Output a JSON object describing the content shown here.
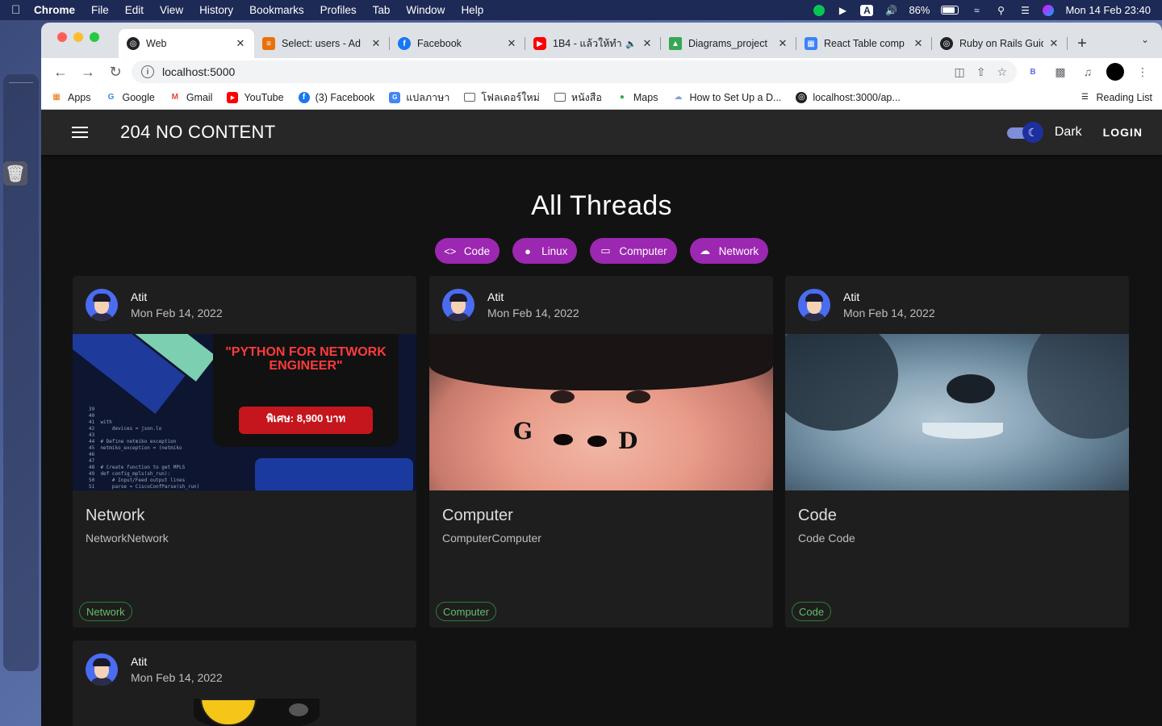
{
  "menubar": {
    "app_name": "Chrome",
    "items": [
      "File",
      "Edit",
      "View",
      "History",
      "Bookmarks",
      "Profiles",
      "Tab",
      "Window",
      "Help"
    ],
    "battery": "86%",
    "datetime": "Mon 14 Feb  23:40",
    "input_indicator": "A"
  },
  "browser": {
    "tabs": [
      {
        "label": "Web",
        "icon": "globe-icon",
        "color": "#202124",
        "active": true
      },
      {
        "label": "Select: users - Ad",
        "icon": "db-icon",
        "color": "#e8710a"
      },
      {
        "label": "Facebook",
        "icon": "facebook-icon",
        "color": "#1877f2"
      },
      {
        "label": "1B4 - แล้วให้ทำ",
        "icon": "youtube-icon",
        "color": "#ff0000"
      },
      {
        "label": "Diagrams_project",
        "icon": "drive-icon",
        "color": "#34a853"
      },
      {
        "label": "React Table comp",
        "icon": "react-table-icon",
        "color": "#3b82f6"
      },
      {
        "label": "Ruby on Rails Guid",
        "icon": "globe-icon",
        "color": "#202124"
      }
    ],
    "url": "localhost:5000",
    "bookmarks": [
      {
        "label": "Apps",
        "icon": "apps-grid-icon"
      },
      {
        "label": "Google",
        "icon": "google-icon"
      },
      {
        "label": "Gmail",
        "icon": "gmail-icon"
      },
      {
        "label": "YouTube",
        "icon": "youtube-icon"
      },
      {
        "label": "(3) Facebook",
        "icon": "facebook-icon"
      },
      {
        "label": "แปลภาษา",
        "icon": "translate-icon"
      },
      {
        "label": "โฟลเดอร์ใหม่",
        "icon": "folder-icon"
      },
      {
        "label": "หนังสือ",
        "icon": "folder-icon"
      },
      {
        "label": "Maps",
        "icon": "maps-icon"
      },
      {
        "label": "How to Set Up a D...",
        "icon": "cloud-icon"
      },
      {
        "label": "localhost:3000/ap...",
        "icon": "globe-icon"
      }
    ],
    "reading_list": "Reading List"
  },
  "app": {
    "brand": "204 NO CONTENT",
    "theme_label": "Dark",
    "login_label": "LOGIN",
    "page_title": "All Threads",
    "chips": [
      {
        "label": "Code",
        "icon": "code-icon"
      },
      {
        "label": "Linux",
        "icon": "linux-icon"
      },
      {
        "label": "Computer",
        "icon": "laptop-icon"
      },
      {
        "label": "Network",
        "icon": "cloud-icon"
      }
    ],
    "threads": [
      {
        "author": "Atit",
        "date": "Mon Feb 14, 2022",
        "title": "Network",
        "description": "NetworkNetwork",
        "tag": "Network",
        "image_text": {
          "headline": "\"PYTHON FOR NETWORK ENGINEER\"",
          "price": "พิเศษ: 8,900 บาท"
        }
      },
      {
        "author": "Atit",
        "date": "Mon Feb 14, 2022",
        "title": "Computer",
        "description": "ComputerComputer",
        "tag": "Computer",
        "image_text": {
          "letter_left": "G",
          "letter_right": "D"
        }
      },
      {
        "author": "Atit",
        "date": "Mon Feb 14, 2022",
        "title": "Code",
        "description": "Code Code",
        "tag": "Code"
      },
      {
        "author": "Atit",
        "date": "Mon Feb 14, 2022"
      }
    ]
  },
  "colors": {
    "app_bg": "#121212",
    "appbar_bg": "#272727",
    "card_bg": "#1e1e1e",
    "chip_purple": "#9c27b0",
    "tag_green": "#66bb6a",
    "avatar_blue": "#4a6cf0"
  }
}
